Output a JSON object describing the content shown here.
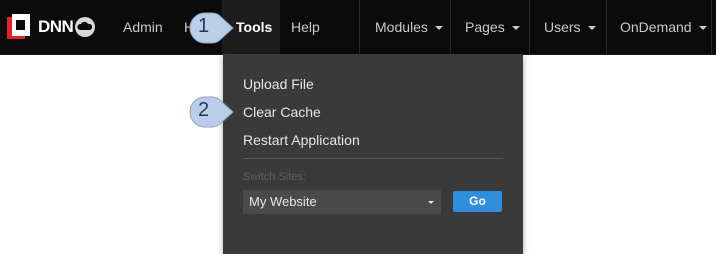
{
  "brand": {
    "logo_text": "DNN"
  },
  "nav": {
    "admin": "Admin",
    "hidden_partial": "H",
    "tools": "Tools",
    "help": "Help",
    "modules": "Modules",
    "pages": "Pages",
    "users": "Users",
    "ondemand": "OnDemand"
  },
  "tools_menu": {
    "items": [
      "Upload File",
      "Clear Cache",
      "Restart Application"
    ],
    "switch_sites_label": "Switch Sites:",
    "site_select_value": "My Website",
    "go_label": "Go"
  },
  "callouts": {
    "step1": "1",
    "step2": "2"
  },
  "colors": {
    "topbar": "#0b0b0b",
    "dropdown": "#3a3a3a",
    "go_button": "#2f8fdc",
    "callout_fill": "#b9cfe8"
  }
}
